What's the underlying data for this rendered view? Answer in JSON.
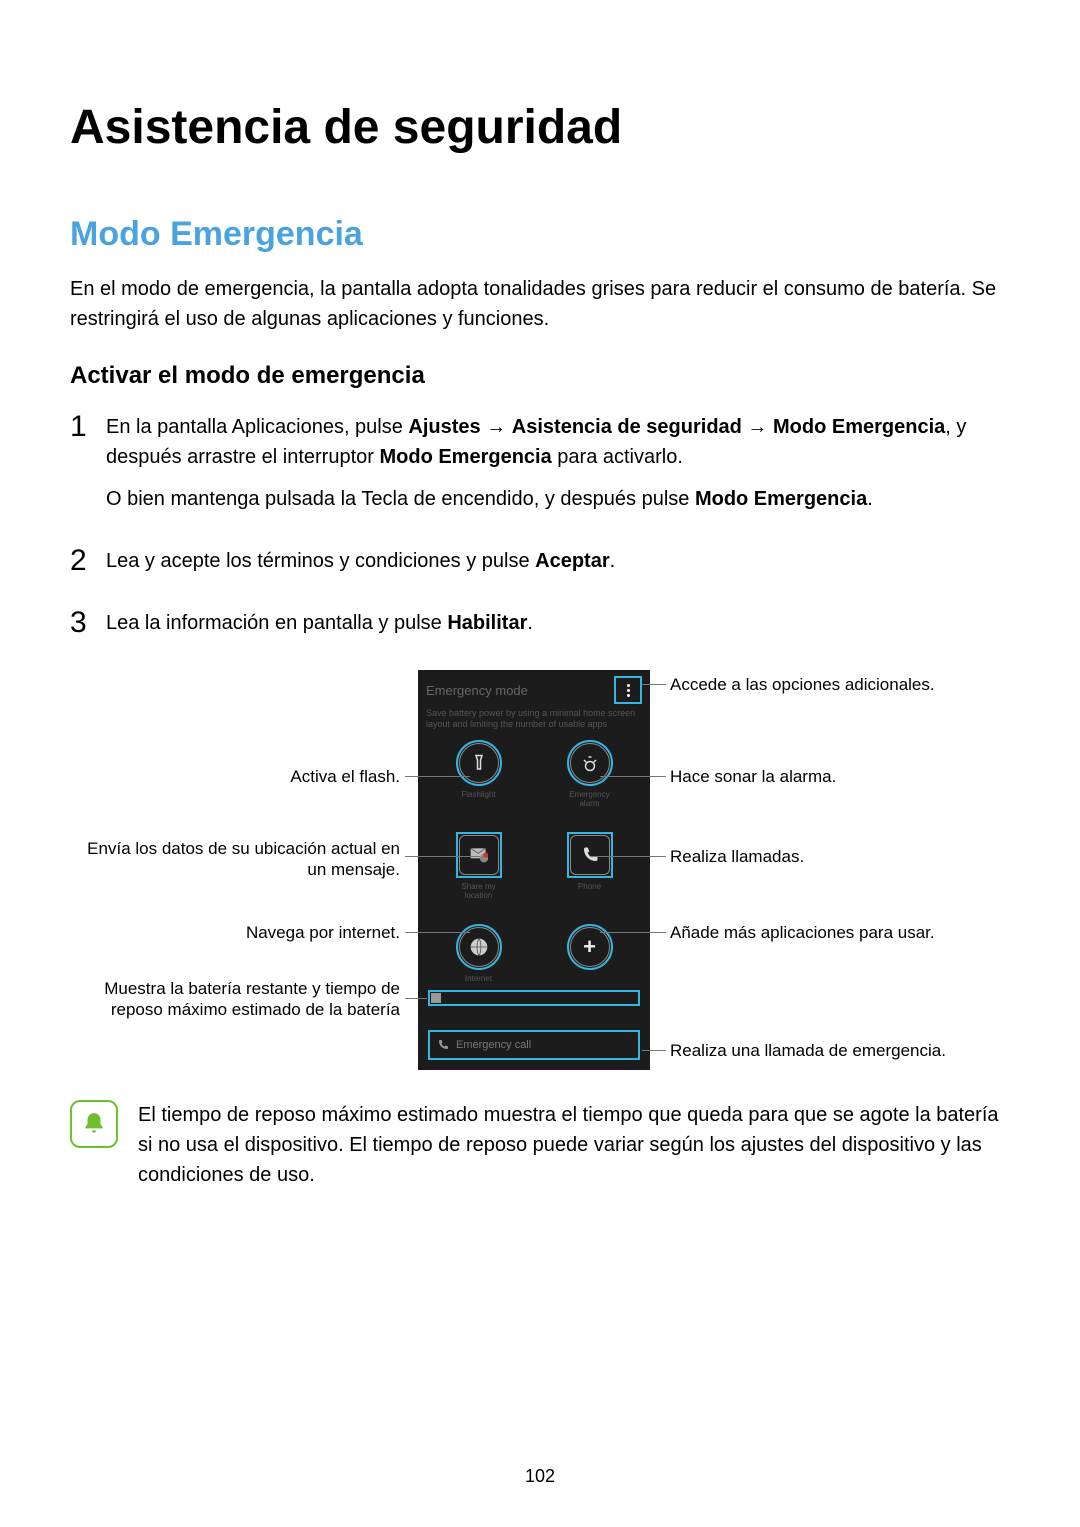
{
  "page_title": "Asistencia de seguridad",
  "section_title": "Modo Emergencia",
  "intro": "En el modo de emergencia, la pantalla adopta tonalidades grises para reducir el consumo de batería. Se restringirá el uso de algunas aplicaciones y funciones.",
  "sub_title": "Activar el modo de emergencia",
  "steps": {
    "s1": {
      "num": "1",
      "t1a": "En la pantalla Aplicaciones, pulse ",
      "t1b": "Ajustes",
      "t1c": " → ",
      "t1d": "Asistencia de seguridad",
      "t1e": " → ",
      "t1f": "Modo Emergencia",
      "t1g": ", y después arrastre el interruptor ",
      "t1h": "Modo Emergencia",
      "t1i": " para activarlo.",
      "t2a": "O bien mantenga pulsada la Tecla de encendido, y después pulse ",
      "t2b": "Modo Emergencia",
      "t2c": "."
    },
    "s2": {
      "num": "2",
      "t1a": "Lea y acepte los términos y condiciones y pulse ",
      "t1b": "Aceptar",
      "t1c": "."
    },
    "s3": {
      "num": "3",
      "t1a": "Lea la información en pantalla y pulse ",
      "t1b": "Habilitar",
      "t1c": "."
    }
  },
  "phone": {
    "header": "Emergency mode",
    "sub": "Save battery power by using a minimal home screen layout and limiting the number of usable apps",
    "apps": {
      "flashlight": "Flashlight",
      "alarm": "Emergency alarm",
      "share": "Share my location",
      "phone": "Phone",
      "internet": "Internet",
      "add": "+"
    },
    "emergency_call": "Emergency call"
  },
  "callouts": {
    "menu": "Accede a las opciones adicionales.",
    "flash": "Activa el flash.",
    "alarm": "Hace sonar la alarma.",
    "share": "Envía los datos de su ubicación actual en un mensaje.",
    "call": "Realiza llamadas.",
    "internet": "Navega por internet.",
    "add": "Añade más aplicaciones para usar.",
    "battery": "Muestra la batería restante y tiempo de reposo máximo estimado de la batería",
    "em_call": "Realiza una llamada de emergencia."
  },
  "note": "El tiempo de reposo máximo estimado muestra el tiempo que queda para que se agote la batería si no usa el dispositivo. El tiempo de reposo puede variar según los ajustes del dispositivo y las condiciones de uso.",
  "page_number": "102"
}
